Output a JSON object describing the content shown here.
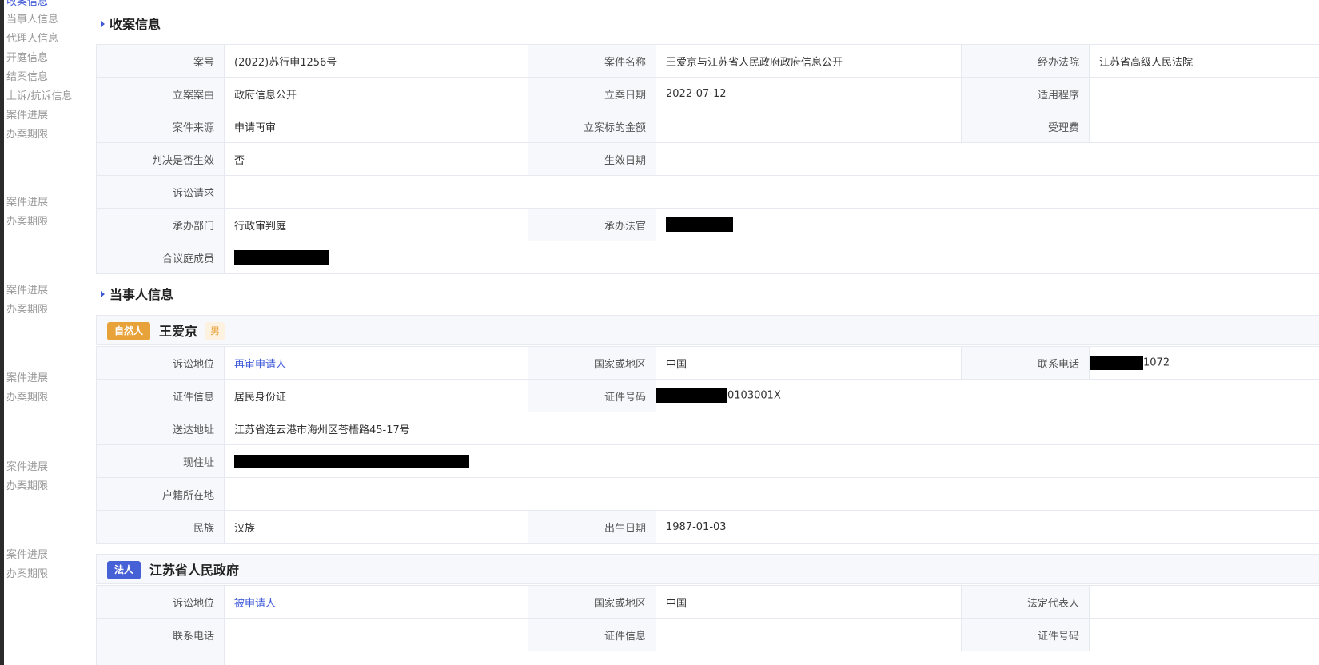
{
  "sidebar": {
    "groups": [
      {
        "items": [
          "收案信息",
          "当事人信息",
          "代理人信息",
          "开庭信息",
          "结案信息",
          "上诉/抗诉信息",
          "案件进展",
          "办案期限"
        ]
      },
      {
        "items": [
          "案件进展",
          "办案期限"
        ]
      },
      {
        "items": [
          "案件进展",
          "办案期限"
        ]
      },
      {
        "items": [
          "案件进展",
          "办案期限"
        ]
      },
      {
        "items": [
          "案件进展",
          "办案期限"
        ]
      },
      {
        "items": [
          "案件进展",
          "办案期限"
        ]
      }
    ],
    "active": "收案信息"
  },
  "case_info": {
    "title": "收案信息",
    "case_no_label": "案号",
    "case_no": "(2022)苏行申1256号",
    "case_name_label": "案件名称",
    "case_name": "王爱京与江苏省人民政府政府信息公开",
    "court_label": "经办法院",
    "court": "江苏省高级人民法院",
    "cause_label": "立案案由",
    "cause": "政府信息公开",
    "filing_date_label": "立案日期",
    "filing_date": "2022-07-12",
    "procedure_label": "适用程序",
    "procedure": "",
    "source_label": "案件来源",
    "source": "申请再审",
    "amount_label": "立案标的金额",
    "amount": "",
    "fee_label": "受理费",
    "fee": "",
    "effective_label": "判决是否生效",
    "effective": "否",
    "effective_date_label": "生效日期",
    "effective_date": "",
    "claim_label": "诉讼请求",
    "claim": "",
    "dept_label": "承办部门",
    "dept": "行政审判庭",
    "judge_label": "承办法官",
    "panel_label": "合议庭成员"
  },
  "party_info": {
    "title": "当事人信息",
    "person": {
      "type_badge": "自然人",
      "name": "王爱京",
      "gender": "男",
      "status_label": "诉讼地位",
      "status": "再审申请人",
      "country_label": "国家或地区",
      "country": "中国",
      "phone_label": "联系电话",
      "phone_suffix": "1072",
      "id_type_label": "证件信息",
      "id_type": "居民身份证",
      "id_no_label": "证件号码",
      "id_no_suffix": "0103001X",
      "address_label": "送达地址",
      "address": "江苏省连云港市海州区苍梧路45-17号",
      "residence_label": "现住址",
      "hukou_label": "户籍所在地",
      "hukou": "",
      "ethnicity_label": "民族",
      "ethnicity": "汉族",
      "birth_label": "出生日期",
      "birth": "1987-01-03"
    },
    "org": {
      "type_badge": "法人",
      "name": "江苏省人民政府",
      "status_label": "诉讼地位",
      "status": "被申请人",
      "country_label": "国家或地区",
      "country": "中国",
      "rep_label": "法定代表人",
      "rep": "",
      "phone_label": "联系电话",
      "phone": "",
      "id_type_label": "证件信息",
      "id_type": "",
      "id_no_label": "证件号码",
      "id_no": ""
    }
  },
  "colors": {
    "accent": "#3f5ad8",
    "natural_badge": "#e8a23a",
    "legal_badge": "#4660d6",
    "label_bg": "#f7f8fc",
    "border": "#e6e9f0"
  }
}
